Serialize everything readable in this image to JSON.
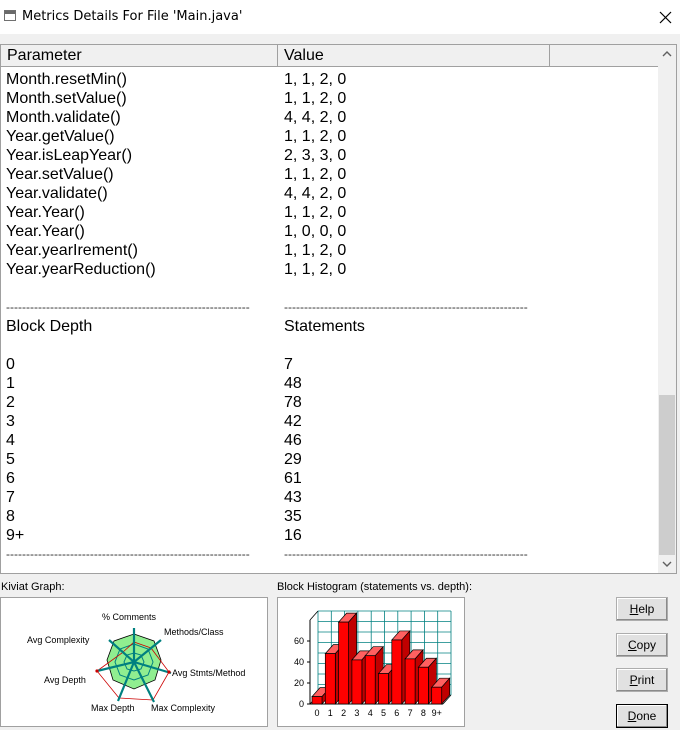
{
  "window": {
    "title": "Metrics Details For File 'Main.java'"
  },
  "table": {
    "headers": [
      "Parameter",
      "Value",
      ""
    ],
    "rows": [
      {
        "param": "Month.resetMin()",
        "value": "1, 1, 2, 0"
      },
      {
        "param": "Month.setValue()",
        "value": "1, 1, 2, 0"
      },
      {
        "param": "Month.validate()",
        "value": "4, 4, 2, 0"
      },
      {
        "param": "Year.getValue()",
        "value": "1, 1, 2, 0"
      },
      {
        "param": "Year.isLeapYear()",
        "value": "2, 3, 3, 0"
      },
      {
        "param": "Year.setValue()",
        "value": "1, 1, 2, 0"
      },
      {
        "param": "Year.validate()",
        "value": "4, 4, 2, 0"
      },
      {
        "param": "Year.Year()",
        "value": "1, 1, 2, 0"
      },
      {
        "param": "Year.Year()",
        "value": "1, 0, 0, 0"
      },
      {
        "param": "Year.yearIrement()",
        "value": "1, 1, 2, 0"
      },
      {
        "param": "Year.yearReduction()",
        "value": "1, 1, 2, 0"
      }
    ],
    "separator": "-------------------------------------------------------------",
    "block_header": {
      "param": "Block Depth",
      "value": "Statements"
    },
    "block_rows": [
      {
        "param": "0",
        "value": "7"
      },
      {
        "param": "1",
        "value": "48"
      },
      {
        "param": "2",
        "value": "78"
      },
      {
        "param": "3",
        "value": "42"
      },
      {
        "param": "4",
        "value": "46"
      },
      {
        "param": "5",
        "value": "29"
      },
      {
        "param": "6",
        "value": "61"
      },
      {
        "param": "7",
        "value": "43"
      },
      {
        "param": "8",
        "value": "35"
      },
      {
        "param": "9+",
        "value": "16"
      }
    ]
  },
  "kiviat": {
    "label": "Kiviat Graph:",
    "axes": [
      "% Comments",
      "Methods/Class",
      "Avg Stmts/Method",
      "Max Complexity",
      "Max Depth",
      "Avg Depth",
      "Avg Complexity"
    ]
  },
  "histogram": {
    "label": "Block Histogram (statements vs. depth):",
    "y_ticks": [
      "60",
      "40",
      "20",
      "0"
    ],
    "x_ticks": [
      "0",
      "1",
      "2",
      "3",
      "4",
      "5",
      "6",
      "7",
      "8",
      "9+"
    ]
  },
  "buttons": {
    "help": {
      "hot": "H",
      "rest": "elp"
    },
    "copy": {
      "hot": "C",
      "rest": "opy"
    },
    "print": {
      "hot": "P",
      "rest": "rint"
    },
    "done": {
      "hot": "D",
      "rest": "one"
    }
  },
  "colors": {
    "bar_red": "#ff0000",
    "kiviat_green": "#90ee90",
    "kiviat_teal": "#008080",
    "grid_teal": "#008080",
    "title_accent": "#3c7fd0"
  },
  "chart_data": {
    "type": "bar",
    "categories": [
      "0",
      "1",
      "2",
      "3",
      "4",
      "5",
      "6",
      "7",
      "8",
      "9+"
    ],
    "values": [
      7,
      48,
      78,
      42,
      46,
      29,
      61,
      43,
      35,
      16
    ],
    "title": "Block Histogram (statements vs. depth):",
    "xlabel": "",
    "ylabel": "",
    "ylim": [
      0,
      80
    ],
    "grid": true
  }
}
